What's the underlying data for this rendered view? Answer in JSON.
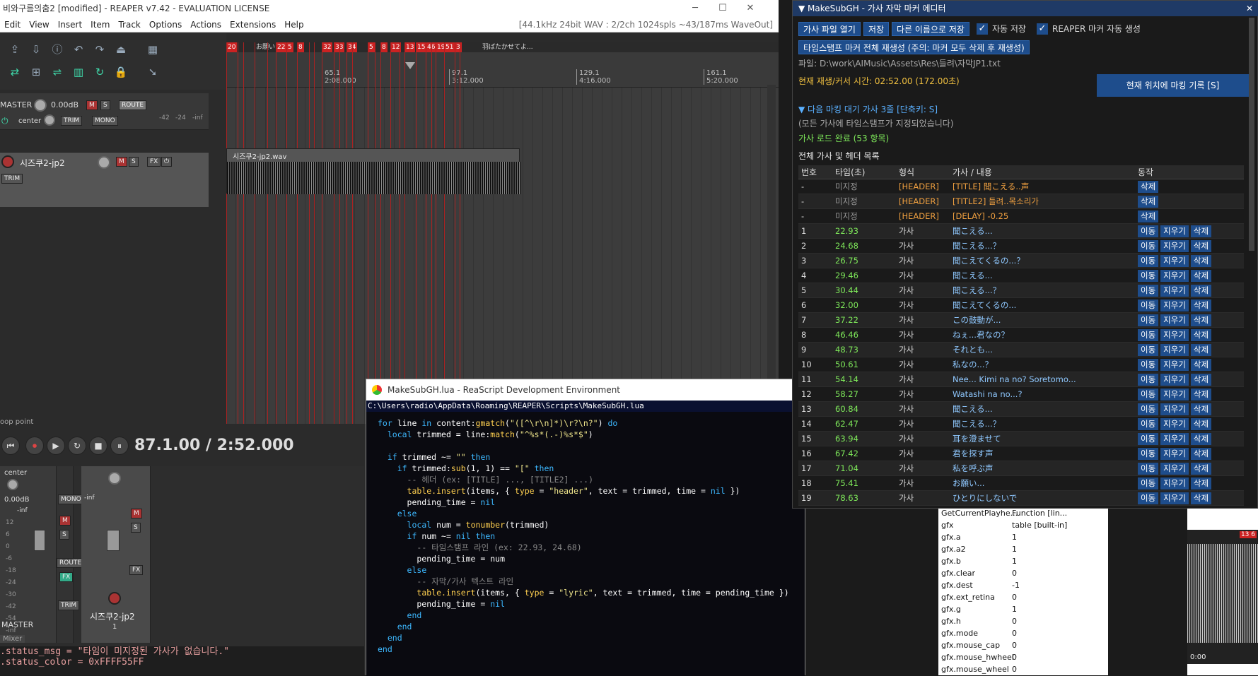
{
  "reaper": {
    "title": "비와구름의춤2 [modified] - REAPER v7.42 - EVALUATION LICENSE",
    "menu": [
      "Edit",
      "View",
      "Insert",
      "Item",
      "Track",
      "Options",
      "Actions",
      "Extensions",
      "Help"
    ],
    "info": "[44.1kHz 24bit WAV : 2/2ch 1024spls ~43/187ms WaveOut]",
    "master": {
      "label": "MASTER",
      "volume": "0.00dB",
      "pan": "center",
      "route": "ROUTE",
      "trim": "TRIM",
      "mono": "MONO",
      "meter": [
        "-42",
        "-24",
        "-inf"
      ]
    },
    "track": {
      "name": "시즈쿠2-jp2",
      "item_name": "시즈쿠2-jp2.wav",
      "trim": "TRIM"
    },
    "markers": [
      "20",
      "お願い",
      "22",
      "5",
      "8",
      "32",
      "33",
      "34",
      "5",
      "8",
      "12",
      "13",
      "15",
      "46",
      "19",
      "51",
      "3",
      "羽ばたかせてよ..."
    ],
    "ruler": [
      {
        "top": "65.1",
        "bot": "2:08.000"
      },
      {
        "top": "97.1",
        "bot": "3:12.000"
      },
      {
        "top": "129.1",
        "bot": "4:16.000"
      },
      {
        "top": "161.1",
        "bot": "5:20.000"
      }
    ],
    "loop_label": "oop point",
    "transport_time": "87.1.00 / 2:52.000",
    "mixer": {
      "pan": "center",
      "vol": "0.00dB",
      "peak": "-inf",
      "scale": [
        "12",
        "6",
        "0",
        "-6",
        "-18",
        "-24",
        "-30",
        "-42",
        "-54",
        "-inf"
      ],
      "master_label": "MASTER",
      "track_label": "시즈쿠2-jp2",
      "track_num": "1",
      "mixer_tab": "Mixer",
      "route": "ROUTE",
      "trim": "TRIM",
      "mono": "MONO"
    },
    "code_bottom": [
      ".status_msg = \"타임이 미지정된 가사가 없습니다.\"",
      ".status_color = 0xFFFF55FF"
    ]
  },
  "ide": {
    "title": "MakeSubGH.lua - ReaScript Development Environment",
    "path": "C:\\Users\\radio\\AppData\\Roaming\\REAPER\\Scripts\\MakeSubGH.lua"
  },
  "vars": [
    {
      "k": "GetCurrentPlayhe...",
      "v": "Function [lin..."
    },
    {
      "k": "gfx",
      "v": "table [built-in]"
    },
    {
      "k": "gfx.a",
      "v": "1"
    },
    {
      "k": "gfx.a2",
      "v": "1"
    },
    {
      "k": "gfx.b",
      "v": "1"
    },
    {
      "k": "gfx.clear",
      "v": "0"
    },
    {
      "k": "gfx.dest",
      "v": "-1"
    },
    {
      "k": "gfx.ext_retina",
      "v": "0"
    },
    {
      "k": "gfx.g",
      "v": "1"
    },
    {
      "k": "gfx.h",
      "v": "0"
    },
    {
      "k": "gfx.mode",
      "v": "0"
    },
    {
      "k": "gfx.mouse_cap",
      "v": "0"
    },
    {
      "k": "gfx.mouse_hwheel",
      "v": "0"
    },
    {
      "k": "gfx.mouse_wheel",
      "v": "0"
    }
  ],
  "wave_box": {
    "time": "0:00",
    "counter": "13 6"
  },
  "msg": {
    "title": "MakeSubGH - 가사 자막 마커 에디터",
    "open": "가사 파일 열기",
    "save": "저장",
    "save_as": "다른 이름으로 저장",
    "auto_save": "자동 저장",
    "auto_marker": "REAPER 마커 자동 생성",
    "regen": "타임스탬프 마커 전체 재생성 (주의: 마커 모두 삭제 후 재생성)",
    "file": "파일: D:\\work\\AIMusic\\Assets\\Res\\들려\\자막JP1.txt",
    "time": "현재 재생/커서 시간: 02:52.00 (172.00초)",
    "mark_btn": "현재 위치에 마킹 기록 [S]",
    "next": "▼ 다음 마킹 대기 가사 3줄 [단축키: S]",
    "all_done": "(모든 가사에 타임스탬프가 지정되었습니다)",
    "loaded": "가사 로드 완료 (53 항목)",
    "list_title": "전체 가사 및 헤더 목록",
    "headers": [
      "번호",
      "타임(초)",
      "형식",
      "가사 / 내용",
      "동작"
    ],
    "btn_move": "이동",
    "btn_clear": "지우기",
    "btn_delete": "삭제",
    "rows": [
      {
        "n": "-",
        "t": "미지정",
        "type": "[HEADER]",
        "text": "[TITLE] 聞こえる..声",
        "h": true
      },
      {
        "n": "-",
        "t": "미지정",
        "type": "[HEADER]",
        "text": "[TITLE2] 들려..목소리가",
        "h": true
      },
      {
        "n": "-",
        "t": "미지정",
        "type": "[HEADER]",
        "text": "[DELAY] -0.25",
        "h": true
      },
      {
        "n": "1",
        "t": "22.93",
        "type": "가사",
        "text": "聞こえる..."
      },
      {
        "n": "2",
        "t": "24.68",
        "type": "가사",
        "text": "聞こえる...？"
      },
      {
        "n": "3",
        "t": "26.75",
        "type": "가사",
        "text": "聞こえてくるの...？"
      },
      {
        "n": "4",
        "t": "29.46",
        "type": "가사",
        "text": "聞こえる..."
      },
      {
        "n": "5",
        "t": "30.44",
        "type": "가사",
        "text": "聞こえる...？"
      },
      {
        "n": "6",
        "t": "32.00",
        "type": "가사",
        "text": "聞こえてくるの..."
      },
      {
        "n": "7",
        "t": "37.22",
        "type": "가사",
        "text": "この鼓動が..."
      },
      {
        "n": "8",
        "t": "46.46",
        "type": "가사",
        "text": "ねぇ...君なの？"
      },
      {
        "n": "9",
        "t": "48.73",
        "type": "가사",
        "text": "それとも..."
      },
      {
        "n": "10",
        "t": "50.61",
        "type": "가사",
        "text": "私なの...？"
      },
      {
        "n": "11",
        "t": "54.14",
        "type": "가사",
        "text": "Nee... Kimi na no? Soretomo..."
      },
      {
        "n": "12",
        "t": "58.27",
        "type": "가사",
        "text": "Watashi na no...?"
      },
      {
        "n": "13",
        "t": "60.84",
        "type": "가사",
        "text": "聞こえる..."
      },
      {
        "n": "14",
        "t": "62.47",
        "type": "가사",
        "text": "聞こえる...？"
      },
      {
        "n": "15",
        "t": "63.94",
        "type": "가사",
        "text": "耳を澄ませて"
      },
      {
        "n": "16",
        "t": "67.42",
        "type": "가사",
        "text": "君を探す声"
      },
      {
        "n": "17",
        "t": "71.04",
        "type": "가사",
        "text": "私を呼ぶ声"
      },
      {
        "n": "18",
        "t": "75.41",
        "type": "가사",
        "text": "お願い..."
      },
      {
        "n": "19",
        "t": "78.63",
        "type": "가사",
        "text": "ひとりにしないで"
      }
    ]
  }
}
